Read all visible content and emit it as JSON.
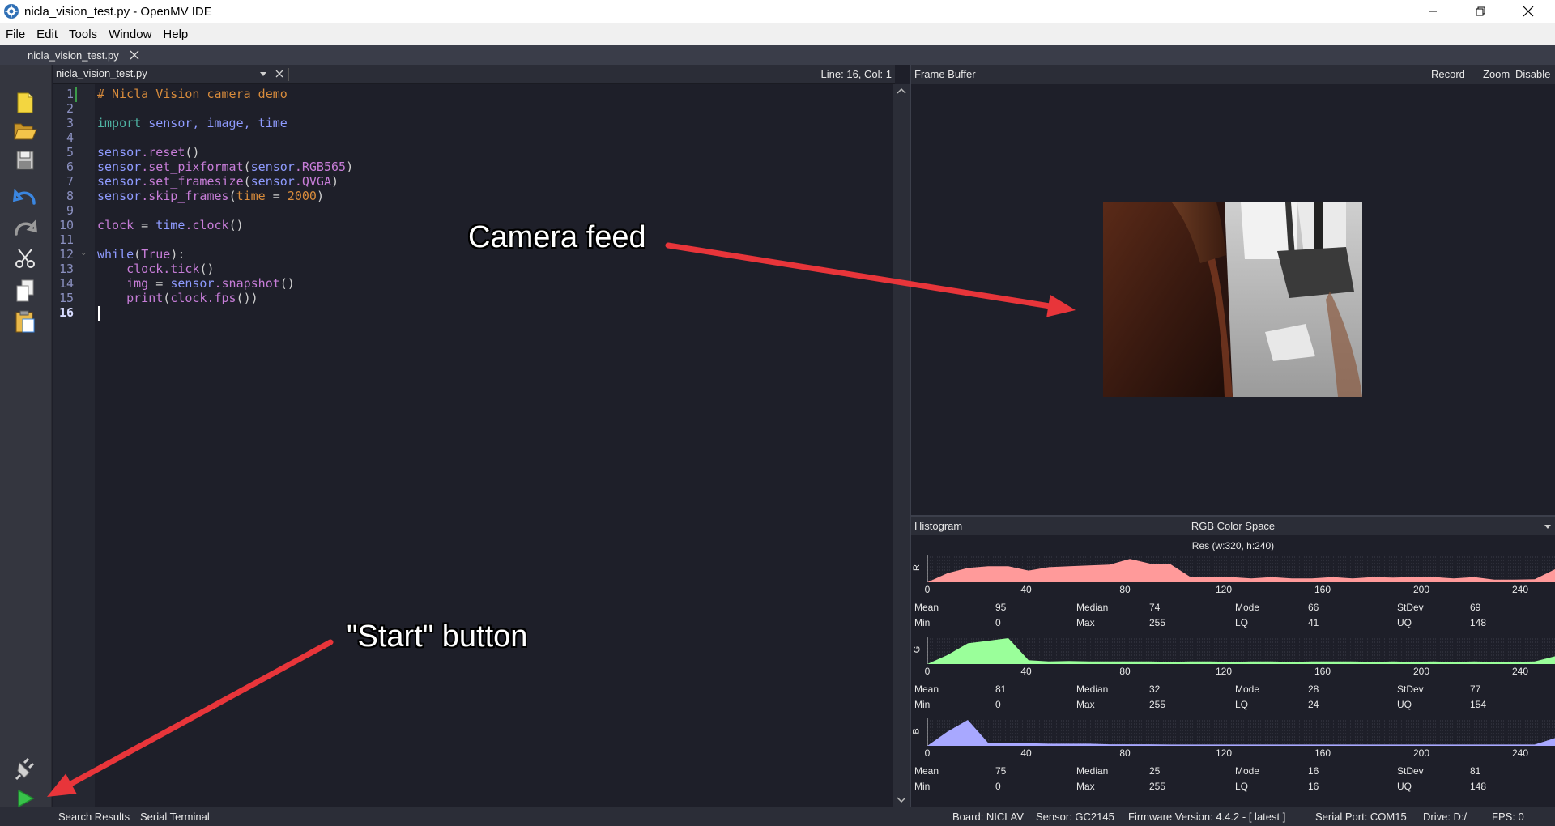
{
  "window": {
    "title": "nicla_vision_test.py - OpenMV IDE",
    "controls": [
      "minimize-icon",
      "restore-icon",
      "close-icon"
    ]
  },
  "menu": [
    "File",
    "Edit",
    "Tools",
    "Window",
    "Help"
  ],
  "file_tab": {
    "label": "nicla_vision_test.py"
  },
  "toolbar": {
    "items": [
      "new-file-icon",
      "open-folder-icon",
      "save-icon",
      "undo-icon",
      "redo-icon",
      "cut-icon",
      "copy-icon",
      "paste-icon"
    ],
    "bottom": [
      "connect-icon",
      "start-icon"
    ]
  },
  "editor": {
    "file": "nicla_vision_test.py",
    "position": "Line: 16, Col: 1",
    "current_line": 16,
    "lines": [
      [
        {
          "t": "# Nicla Vision camera demo",
          "c": "#d98c3c"
        }
      ],
      [],
      [
        {
          "t": "import",
          "c": "#4fb3a3"
        },
        {
          "t": " sensor, image, time",
          "c": "#8f9bff"
        }
      ],
      [],
      [
        {
          "t": "sensor",
          "c": "#8f9bff"
        },
        {
          "t": ".reset",
          "c": "#c77dd8"
        },
        {
          "t": "()",
          "c": "#cfcfcf"
        }
      ],
      [
        {
          "t": "sensor",
          "c": "#8f9bff"
        },
        {
          "t": ".set_pixformat",
          "c": "#c77dd8"
        },
        {
          "t": "(",
          "c": "#cfcfcf"
        },
        {
          "t": "sensor",
          "c": "#8f9bff"
        },
        {
          "t": ".RGB565",
          "c": "#c77dd8"
        },
        {
          "t": ")",
          "c": "#cfcfcf"
        }
      ],
      [
        {
          "t": "sensor",
          "c": "#8f9bff"
        },
        {
          "t": ".set_framesize",
          "c": "#c77dd8"
        },
        {
          "t": "(",
          "c": "#cfcfcf"
        },
        {
          "t": "sensor",
          "c": "#8f9bff"
        },
        {
          "t": ".QVGA",
          "c": "#c77dd8"
        },
        {
          "t": ")",
          "c": "#cfcfcf"
        }
      ],
      [
        {
          "t": "sensor",
          "c": "#8f9bff"
        },
        {
          "t": ".skip_frames",
          "c": "#c77dd8"
        },
        {
          "t": "(",
          "c": "#cfcfcf"
        },
        {
          "t": "time",
          "c": "#d98c3c"
        },
        {
          "t": " = ",
          "c": "#cfcfcf"
        },
        {
          "t": "2000",
          "c": "#d98c3c"
        },
        {
          "t": ")",
          "c": "#cfcfcf"
        }
      ],
      [],
      [
        {
          "t": "clock",
          "c": "#c77dd8"
        },
        {
          "t": " = ",
          "c": "#cfcfcf"
        },
        {
          "t": "time",
          "c": "#8f9bff"
        },
        {
          "t": ".clock",
          "c": "#c77dd8"
        },
        {
          "t": "()",
          "c": "#cfcfcf"
        }
      ],
      [],
      [
        {
          "t": "while",
          "c": "#8f9bff"
        },
        {
          "t": "(",
          "c": "#cfcfcf"
        },
        {
          "t": "True",
          "c": "#c77dd8"
        },
        {
          "t": "):",
          "c": "#cfcfcf"
        }
      ],
      [
        {
          "t": "    clock",
          "c": "#c77dd8"
        },
        {
          "t": ".tick",
          "c": "#c77dd8"
        },
        {
          "t": "()",
          "c": "#cfcfcf"
        }
      ],
      [
        {
          "t": "    img",
          "c": "#c77dd8"
        },
        {
          "t": " = ",
          "c": "#cfcfcf"
        },
        {
          "t": "sensor",
          "c": "#8f9bff"
        },
        {
          "t": ".snapshot",
          "c": "#c77dd8"
        },
        {
          "t": "()",
          "c": "#cfcfcf"
        }
      ],
      [
        {
          "t": "    print",
          "c": "#c77dd8"
        },
        {
          "t": "(",
          "c": "#cfcfcf"
        },
        {
          "t": "clock",
          "c": "#c77dd8"
        },
        {
          "t": ".fps",
          "c": "#c77dd8"
        },
        {
          "t": "())",
          "c": "#cfcfcf"
        }
      ],
      []
    ]
  },
  "frame_buffer": {
    "title": "Frame Buffer",
    "buttons": [
      "Record",
      "Zoom",
      "Disable"
    ]
  },
  "histogram": {
    "title": "Histogram",
    "color_space": "RGB Color Space",
    "resolution": "Res (w:320, h:240)",
    "x_ticks": [
      "0",
      "40",
      "80",
      "120",
      "160",
      "200",
      "240"
    ],
    "channels": [
      {
        "label": "R",
        "color": "#ff9a9a",
        "profile": [
          0,
          0.35,
          0.55,
          0.62,
          0.62,
          0.45,
          0.58,
          0.62,
          0.65,
          0.68,
          0.9,
          0.72,
          0.7,
          0.2,
          0.2,
          0.2,
          0.15,
          0.2,
          0.15,
          0.15,
          0.2,
          0.15,
          0.2,
          0.18,
          0.2,
          0.2,
          0.15,
          0.2,
          0.1,
          0.1,
          0.12,
          0.5
        ],
        "stats": [
          [
            "Mean",
            "95"
          ],
          [
            "Median",
            "74"
          ],
          [
            "Mode",
            "66"
          ],
          [
            "StDev",
            "69"
          ],
          [
            "Min",
            "0"
          ],
          [
            "Max",
            "255"
          ],
          [
            "LQ",
            "41"
          ],
          [
            "UQ",
            "148"
          ]
        ]
      },
      {
        "label": "G",
        "color": "#9aff9a",
        "profile": [
          0,
          0.35,
          0.8,
          0.9,
          1.0,
          0.15,
          0.1,
          0.12,
          0.1,
          0.1,
          0.1,
          0.1,
          0.08,
          0.1,
          0.1,
          0.08,
          0.1,
          0.1,
          0.08,
          0.1,
          0.1,
          0.1,
          0.08,
          0.1,
          0.08,
          0.1,
          0.08,
          0.1,
          0.08,
          0.08,
          0.1,
          0.3
        ],
        "stats": [
          [
            "Mean",
            "81"
          ],
          [
            "Median",
            "32"
          ],
          [
            "Mode",
            "28"
          ],
          [
            "StDev",
            "77"
          ],
          [
            "Min",
            "0"
          ],
          [
            "Max",
            "255"
          ],
          [
            "LQ",
            "24"
          ],
          [
            "UQ",
            "154"
          ]
        ]
      },
      {
        "label": "B",
        "color": "#a8a8ff",
        "profile": [
          0,
          0.55,
          1.0,
          0.12,
          0.1,
          0.1,
          0.08,
          0.08,
          0.08,
          0.06,
          0.06,
          0.06,
          0.05,
          0.05,
          0.05,
          0.05,
          0.05,
          0.05,
          0.05,
          0.05,
          0.05,
          0.05,
          0.05,
          0.05,
          0.05,
          0.05,
          0.05,
          0.05,
          0.05,
          0.05,
          0.05,
          0.3
        ],
        "stats": [
          [
            "Mean",
            "75"
          ],
          [
            "Median",
            "25"
          ],
          [
            "Mode",
            "16"
          ],
          [
            "StDev",
            "81"
          ],
          [
            "Min",
            "0"
          ],
          [
            "Max",
            "255"
          ],
          [
            "LQ",
            "16"
          ],
          [
            "UQ",
            "148"
          ]
        ]
      }
    ]
  },
  "bottom_bar": {
    "tabs": [
      "Search Results",
      "Serial Terminal"
    ],
    "board": "Board: NICLAV",
    "sensor": "Sensor: GC2145",
    "firmware": "Firmware Version: 4.4.2 - [ latest ]",
    "serial_port": "Serial Port: COM15",
    "drive": "Drive: D:/",
    "fps": "FPS: 0"
  },
  "annotations": {
    "camera_feed": "Camera feed",
    "start_button": "\"Start\" button",
    "arrow_color": "#e8353a"
  }
}
